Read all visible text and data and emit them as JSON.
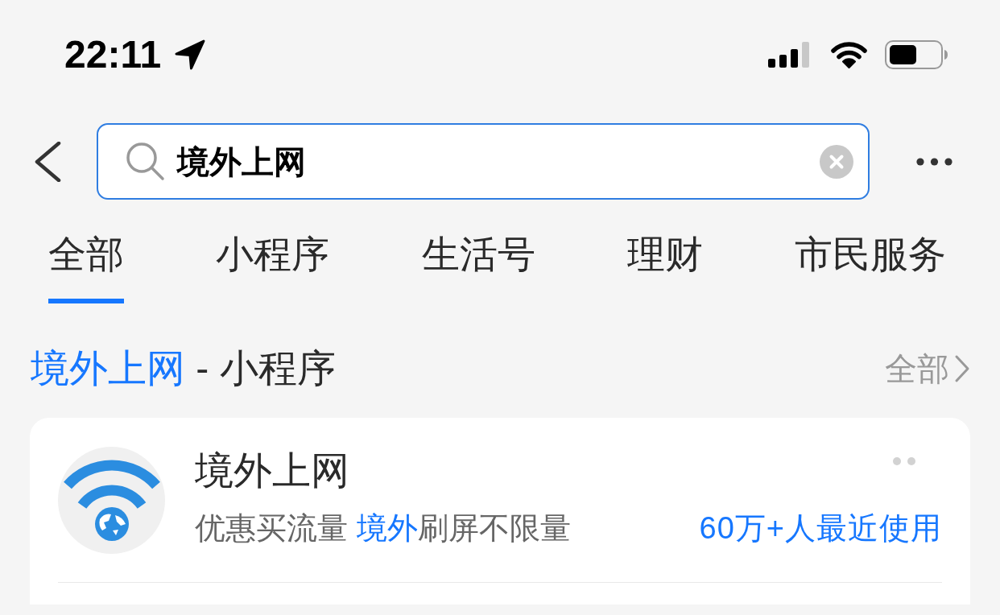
{
  "status_bar": {
    "time": "22:11"
  },
  "search": {
    "value": "境外上网"
  },
  "tabs": [
    {
      "label": "全部",
      "selected": true
    },
    {
      "label": "小程序",
      "selected": false
    },
    {
      "label": "生活号",
      "selected": false
    },
    {
      "label": "理财",
      "selected": false
    },
    {
      "label": "市民服务",
      "selected": false
    }
  ],
  "section": {
    "title": [
      {
        "text": "境外上网",
        "highlight": true
      },
      {
        "text": " - 小程序",
        "highlight": false
      }
    ],
    "view_all": "全部"
  },
  "results": [
    {
      "title": "境外上网",
      "description": [
        {
          "text": "优惠买流量 ",
          "highlight": false
        },
        {
          "text": "境外",
          "highlight": true
        },
        {
          "text": "刷屏不限量",
          "highlight": false
        }
      ],
      "usage": "60万+人最近使用"
    }
  ]
}
